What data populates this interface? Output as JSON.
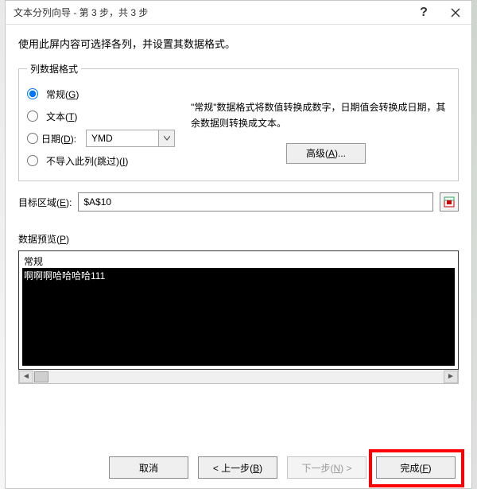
{
  "window": {
    "title": "文本分列向导 - 第 3 步，共 3 步"
  },
  "hint": "使用此屏内容可选择各列，并设置其数据格式。",
  "group": {
    "legend": "列数据格式",
    "radios": {
      "general": "常规",
      "general_key": "G",
      "text": "文本",
      "text_key": "T",
      "date": "日期",
      "date_key": "D",
      "date_value": "YMD",
      "skip": "不导入此列(跳过)",
      "skip_key": "I"
    },
    "explain": "\"常规\"数据格式将数值转换成数字，日期值会转换成日期，其余数据则转换成文本。",
    "advanced": "高级",
    "advanced_key": "A"
  },
  "dest": {
    "label": "目标区域",
    "label_key": "E",
    "value": "$A$10"
  },
  "preview": {
    "label": "数据预览",
    "label_key": "P",
    "col_header": "常规",
    "row1": "啊啊啊哈哈哈哈111"
  },
  "buttons": {
    "cancel": "取消",
    "back": "< 上一步",
    "back_key": "B",
    "next": "下一步",
    "next_key": "N",
    "finish": "完成",
    "finish_key": "F"
  }
}
